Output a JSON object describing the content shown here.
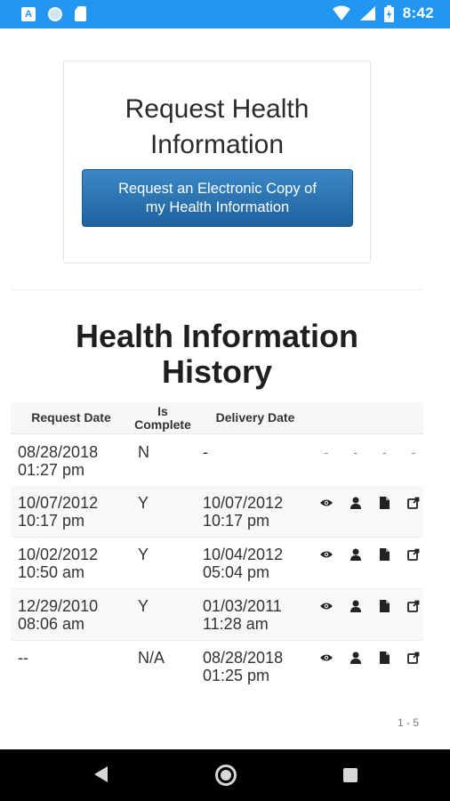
{
  "status_bar": {
    "time": "8:42",
    "left_icons": [
      "a-notification-icon",
      "circle-notification-icon",
      "sd-card-icon"
    ],
    "right_icons": [
      "wifi-icon",
      "signal-icon",
      "battery-icon"
    ]
  },
  "request_card": {
    "title": "Request Health Information",
    "button_label_line1": "Request an Electronic Copy of",
    "button_label_line2": "my Health Information"
  },
  "history": {
    "title_line1": "Health Information",
    "title_line2": "History",
    "columns": {
      "request_date": "Request Date",
      "is_complete_line1": "Is",
      "is_complete_line2": "Complete",
      "delivery_date": "Delivery Date"
    },
    "rows": [
      {
        "req1": "08/28/2018",
        "req2": "01:27 pm",
        "complete": "N",
        "del1": "-",
        "del2": "",
        "actions": "dashes"
      },
      {
        "req1": "10/07/2012",
        "req2": "10:17 pm",
        "complete": "Y",
        "del1": "10/07/2012",
        "del2": "10:17 pm",
        "actions": "icons"
      },
      {
        "req1": "10/02/2012",
        "req2": "10:50 am",
        "complete": "Y",
        "del1": "10/04/2012",
        "del2": "05:04 pm",
        "actions": "icons"
      },
      {
        "req1": "12/29/2010",
        "req2": "08:06 am",
        "complete": "Y",
        "del1": "01/03/2011",
        "del2": "11:28 am",
        "actions": "icons"
      },
      {
        "req1": "--",
        "req2": "",
        "complete": "N/A",
        "del1": "08/28/2018",
        "del2": "01:25 pm",
        "actions": "icons"
      }
    ],
    "action_icons": [
      "eye-icon",
      "person-icon",
      "document-icon",
      "share-icon"
    ],
    "pager": "1 - 5"
  },
  "colors": {
    "status_bar": "#2196f3",
    "button_top": "#3a88c6",
    "button_bottom": "#1f629d"
  }
}
